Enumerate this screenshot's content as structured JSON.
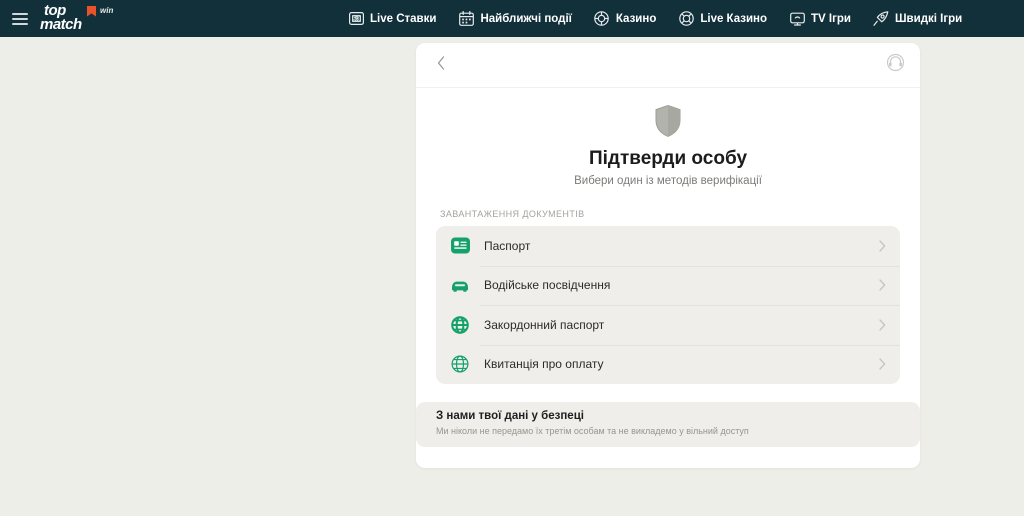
{
  "brand": {
    "logo_top": "top",
    "logo_bottom": "match",
    "logo_win": "win",
    "accent_color": "#e8532b",
    "bar_color": "#12303a"
  },
  "topbar": {
    "menu_icon": "hamburger-icon",
    "nav": [
      {
        "label": "Live Ставки",
        "icon": "scoreboard-icon"
      },
      {
        "label": "Найближчі події",
        "icon": "calendar-icon"
      },
      {
        "label": "Казино",
        "icon": "chip-icon"
      },
      {
        "label": "Live Казино",
        "icon": "live-chip-icon"
      },
      {
        "label": "TV Ігри",
        "icon": "tv-icon"
      },
      {
        "label": "Швидкі Ігри",
        "icon": "rocket-icon"
      }
    ]
  },
  "card": {
    "back_icon": "chevron-left-icon",
    "support_icon": "support-headset-icon",
    "hero": {
      "icon": "shield-icon",
      "title": "Підтверди особу",
      "subtitle": "Вибери один із методів верифікації"
    },
    "section_label": "ЗАВАНТАЖЕННЯ ДОКУМЕНТІВ",
    "methods": [
      {
        "label": "Паспорт",
        "icon": "id-card-icon",
        "chevron": "chevron-right-icon"
      },
      {
        "label": "Водійське посвідчення",
        "icon": "car-icon",
        "chevron": "chevron-right-icon"
      },
      {
        "label": "Закордонний паспорт",
        "icon": "globe-filled-icon",
        "chevron": "chevron-right-icon"
      },
      {
        "label": "Квитанція про оплату",
        "icon": "globe-outline-icon",
        "chevron": "chevron-right-icon"
      }
    ],
    "accent_green": "#16a06a"
  },
  "notice": {
    "title": "З нами твої дані у безпеці",
    "text": "Ми ніколи не передамо їх третім особам та не викладемо у вільний доступ"
  }
}
